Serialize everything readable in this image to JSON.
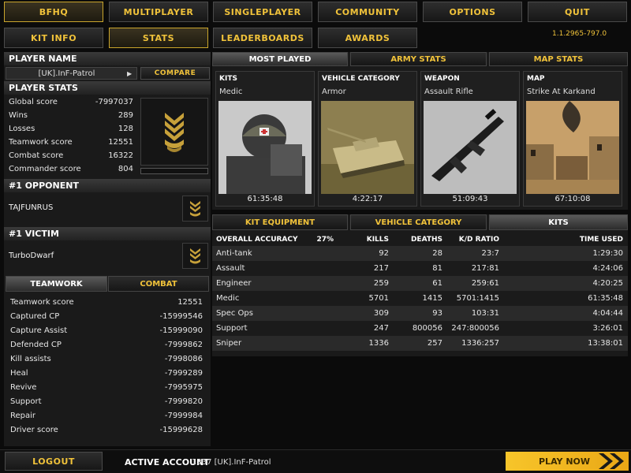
{
  "nav": {
    "top": [
      "BFHQ",
      "MULTIPLAYER",
      "SINGLEPLAYER",
      "COMMUNITY",
      "OPTIONS",
      "QUIT"
    ],
    "sub": [
      "KIT INFO",
      "STATS",
      "LEADERBOARDS",
      "AWARDS"
    ],
    "version": "1.1.2965-797.0"
  },
  "player": {
    "name_header": "PLAYER NAME",
    "name": "[UK].InF-Patrol",
    "compare_label": "COMPARE",
    "stats_header": "PLAYER STATS",
    "stats": [
      {
        "label": "Global score",
        "value": "-7997037"
      },
      {
        "label": "Wins",
        "value": "289"
      },
      {
        "label": "Losses",
        "value": "128"
      },
      {
        "label": "Teamwork score",
        "value": "12551"
      },
      {
        "label": "Combat score",
        "value": "16322"
      },
      {
        "label": "Commander score",
        "value": "804"
      }
    ]
  },
  "opponent": {
    "header": "#1 OPPONENT",
    "name": "TAJFUNRUS"
  },
  "victim": {
    "header": "#1 VICTIM",
    "name": "TurboDwarf"
  },
  "teamwork": {
    "tabs": [
      "TEAMWORK",
      "COMBAT"
    ],
    "rows": [
      {
        "label": "Teamwork score",
        "value": "12551"
      },
      {
        "label": "Captured CP",
        "value": "-15999546"
      },
      {
        "label": "Capture Assist",
        "value": "-15999090"
      },
      {
        "label": "Defended CP",
        "value": "-7999862"
      },
      {
        "label": "Kill assists",
        "value": "-7998086"
      },
      {
        "label": "Heal",
        "value": "-7999289"
      },
      {
        "label": "Revive",
        "value": "-7995975"
      },
      {
        "label": "Support",
        "value": "-7999820"
      },
      {
        "label": "Repair",
        "value": "-7999984"
      },
      {
        "label": "Driver score",
        "value": "-15999628"
      }
    ]
  },
  "most_played": {
    "tabs": [
      "MOST PLAYED",
      "ARMY STATS",
      "MAP STATS"
    ],
    "cards": [
      {
        "title": "KITS",
        "sub": "Medic",
        "time": "61:35:48"
      },
      {
        "title": "VEHICLE CATEGORY",
        "sub": "Armor",
        "time": "4:22:17"
      },
      {
        "title": "WEAPON",
        "sub": "Assault Rifle",
        "time": "51:09:43"
      },
      {
        "title": "MAP",
        "sub": "Strike At Karkand",
        "time": "67:10:08"
      }
    ]
  },
  "kits": {
    "tabs": [
      "KIT EQUIPMENT",
      "VEHICLE CATEGORY",
      "KITS"
    ],
    "headers": [
      "OVERALL ACCURACY",
      "27%",
      "KILLS",
      "DEATHS",
      "K/D RATIO",
      "TIME USED"
    ],
    "rows": [
      {
        "name": "Anti-tank",
        "kills": "92",
        "deaths": "28",
        "kd": "23:7",
        "time": "1:29:30"
      },
      {
        "name": "Assault",
        "kills": "217",
        "deaths": "81",
        "kd": "217:81",
        "time": "4:24:06"
      },
      {
        "name": "Engineer",
        "kills": "259",
        "deaths": "61",
        "kd": "259:61",
        "time": "4:20:25"
      },
      {
        "name": "Medic",
        "kills": "5701",
        "deaths": "1415",
        "kd": "5701:1415",
        "time": "61:35:48"
      },
      {
        "name": "Spec Ops",
        "kills": "309",
        "deaths": "93",
        "kd": "103:31",
        "time": "4:04:44"
      },
      {
        "name": "Support",
        "kills": "247",
        "deaths": "800056",
        "kd": "247:800056",
        "time": "3:26:01"
      },
      {
        "name": "Sniper",
        "kills": "1336",
        "deaths": "257",
        "kd": "1336:257",
        "time": "13:38:01"
      }
    ]
  },
  "footer": {
    "logout": "LOGOUT",
    "active_label": "ACTIVE ACCOUNT",
    "active_value": "1337 [UK].InF-Patrol",
    "play_now": "PLAY NOW"
  },
  "colors": {
    "accent": "#f0c23a",
    "play": "#f3b51e"
  }
}
